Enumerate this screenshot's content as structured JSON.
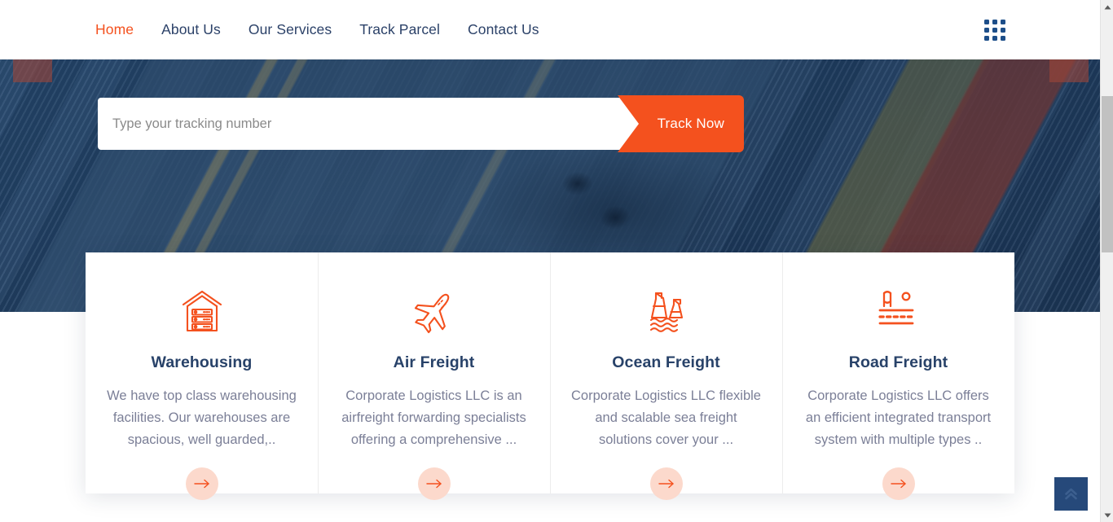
{
  "header": {
    "nav": [
      {
        "label": "Home",
        "active": true
      },
      {
        "label": "About Us",
        "active": false
      },
      {
        "label": "Our Services",
        "active": false
      },
      {
        "label": "Track Parcel",
        "active": false
      },
      {
        "label": "Contact Us",
        "active": false
      }
    ],
    "grid_toggle_icon": "grid-menu-icon"
  },
  "hero": {
    "tracking": {
      "placeholder": "Type your tracking number",
      "value": "",
      "button_label": "Track Now"
    }
  },
  "services": {
    "cards": [
      {
        "icon": "warehouse-icon",
        "title": "Warehousing",
        "text": "We have top class warehousing facilities. Our warehouses are spacious, well guarded,..",
        "arrow_icon": "arrow-right-icon"
      },
      {
        "icon": "airplane-icon",
        "title": "Air Freight",
        "text": "Corporate Logistics LLC is an airfreight forwarding specialists offering a comprehensive ...",
        "arrow_icon": "arrow-right-icon"
      },
      {
        "icon": "ship-waves-icon",
        "title": "Ocean Freight",
        "text": "Corporate Logistics LLC flexible and scalable sea freight solutions cover your ...",
        "arrow_icon": "arrow-right-icon"
      },
      {
        "icon": "road-truck-icon",
        "title": "Road Freight",
        "text": "Corporate Logistics LLC offers an efficient integrated transport system with multiple types ..",
        "arrow_icon": "arrow-right-icon"
      }
    ]
  },
  "scroll_top": {
    "icon": "double-chevron-up-icon"
  },
  "scrollbar": {
    "up_icon": "triangle-up-icon",
    "down_icon": "triangle-down-icon"
  },
  "colors": {
    "accent_orange": "#f4511e",
    "navy": "#284269",
    "body_text": "#7b7f97",
    "arrow_circle": "#fcd9cc",
    "scroll_top_bg": "#26497a"
  }
}
